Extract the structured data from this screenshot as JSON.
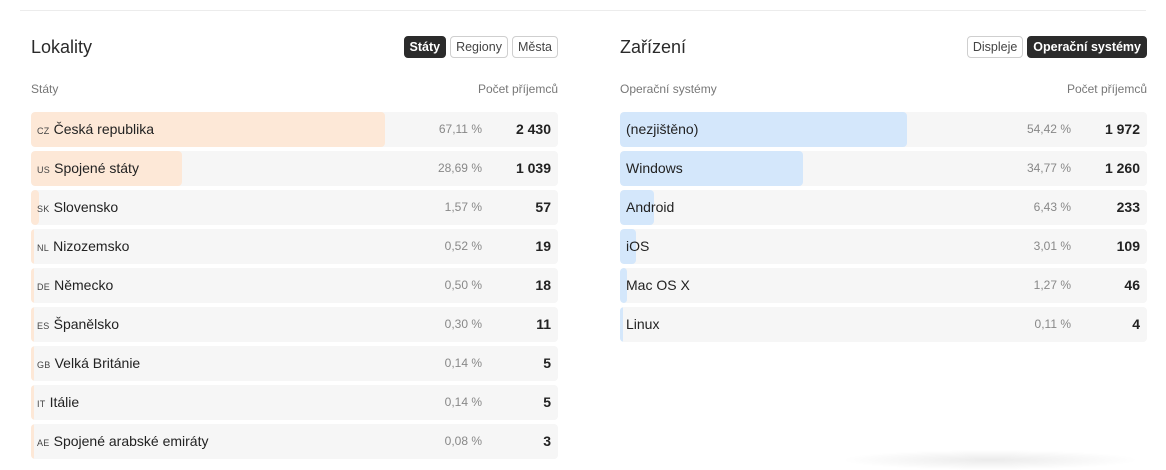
{
  "locality": {
    "title": "Lokality",
    "tabs": [
      {
        "label": "Státy",
        "active": true
      },
      {
        "label": "Regiony",
        "active": false
      },
      {
        "label": "Města",
        "active": false
      }
    ],
    "col_left": "Státy",
    "col_right": "Počet příjemců",
    "rows": [
      {
        "code": "CZ",
        "name": "Česká republika",
        "pct": "67,11 %",
        "count": "2 430",
        "fraction": 0.6711
      },
      {
        "code": "US",
        "name": "Spojené státy",
        "pct": "28,69 %",
        "count": "1 039",
        "fraction": 0.2869
      },
      {
        "code": "SK",
        "name": "Slovensko",
        "pct": "1,57 %",
        "count": "57",
        "fraction": 0.0157
      },
      {
        "code": "NL",
        "name": "Nizozemsko",
        "pct": "0,52 %",
        "count": "19",
        "fraction": 0.0052
      },
      {
        "code": "DE",
        "name": "Německo",
        "pct": "0,50 %",
        "count": "18",
        "fraction": 0.005
      },
      {
        "code": "ES",
        "name": "Španělsko",
        "pct": "0,30 %",
        "count": "11",
        "fraction": 0.003
      },
      {
        "code": "GB",
        "name": "Velká Británie",
        "pct": "0,14 %",
        "count": "5",
        "fraction": 0.0014
      },
      {
        "code": "IT",
        "name": "Itálie",
        "pct": "0,14 %",
        "count": "5",
        "fraction": 0.0014
      },
      {
        "code": "AE",
        "name": "Spojené arabské emiráty",
        "pct": "0,08 %",
        "count": "3",
        "fraction": 0.0008
      }
    ]
  },
  "devices": {
    "title": "Zařízení",
    "tabs": [
      {
        "label": "Displeje",
        "active": false
      },
      {
        "label": "Operační systémy",
        "active": true
      }
    ],
    "col_left": "Operační systémy",
    "col_right": "Počet příjemců",
    "rows": [
      {
        "name": "(nezjištěno)",
        "pct": "54,42 %",
        "count": "1 972",
        "fraction": 0.5442
      },
      {
        "name": "Windows",
        "pct": "34,77 %",
        "count": "1 260",
        "fraction": 0.3477
      },
      {
        "name": "Android",
        "pct": "6,43 %",
        "count": "233",
        "fraction": 0.0643
      },
      {
        "name": "iOS",
        "pct": "3,01 %",
        "count": "109",
        "fraction": 0.0301
      },
      {
        "name": "Mac OS X",
        "pct": "1,27 %",
        "count": "46",
        "fraction": 0.0127
      },
      {
        "name": "Linux",
        "pct": "0,11 %",
        "count": "4",
        "fraction": 0.0011
      }
    ]
  },
  "colors": {
    "locality_bar": "#fde8d7",
    "devices_bar": "#d4e7fb",
    "active_tab_bg": "#2b2b2b"
  }
}
